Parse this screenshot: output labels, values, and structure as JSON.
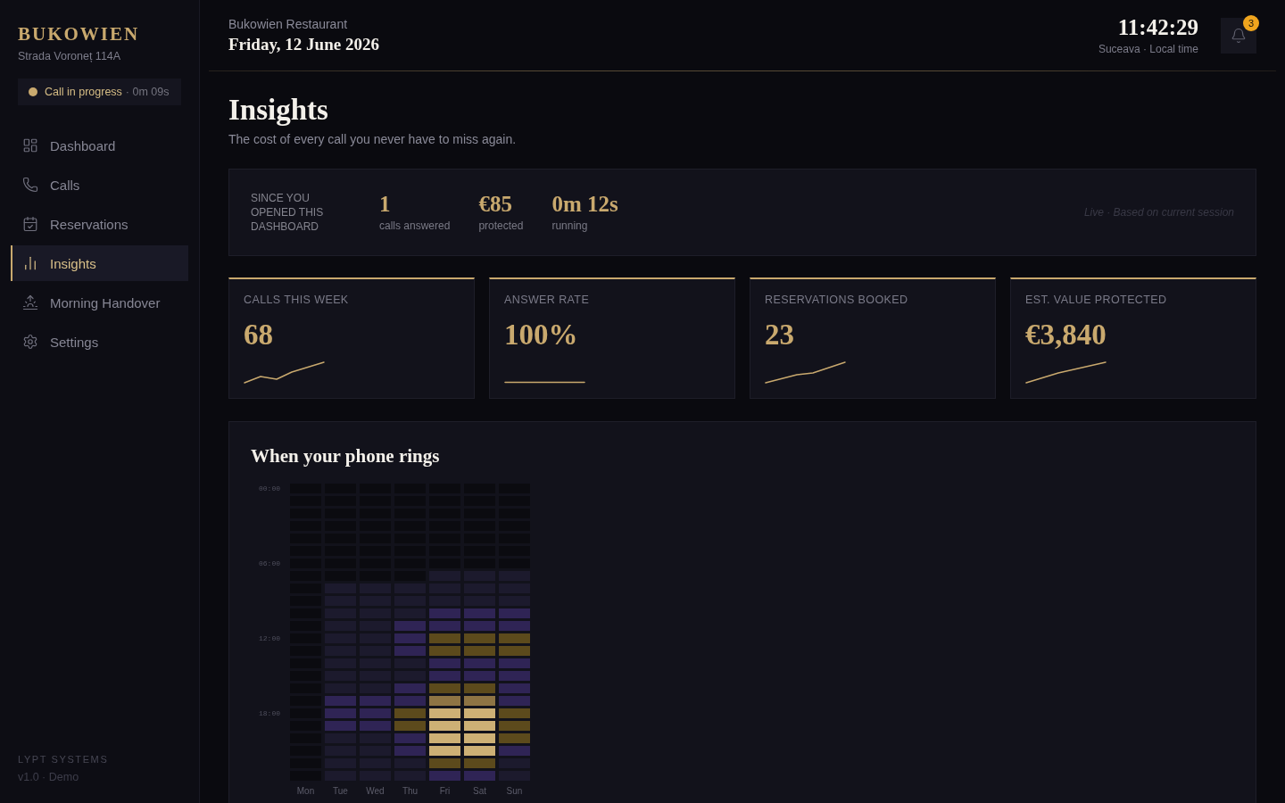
{
  "sidebar": {
    "brand": "BUKOWIEN",
    "address": "Strada Voroneț 114A",
    "call_status": {
      "label": "Call in progress",
      "elapsed": "· 0m 09s"
    },
    "nav": [
      {
        "label": "Dashboard",
        "selected": false
      },
      {
        "label": "Calls",
        "selected": false
      },
      {
        "label": "Reservations",
        "selected": false
      },
      {
        "label": "Insights",
        "selected": true
      },
      {
        "label": "Morning Handover",
        "selected": false
      },
      {
        "label": "Settings",
        "selected": false
      }
    ],
    "footer": {
      "company": "LYPT SYSTEMS",
      "version": "v1.0 · Demo"
    }
  },
  "header": {
    "restaurant": "Bukowien Restaurant",
    "date": "Friday, 12 June 2026",
    "clock": "11:42:29",
    "clock_caption": "Suceava · Local time",
    "notifications": {
      "count": "3"
    }
  },
  "page": {
    "title": "Insights",
    "subtitle": "The cost of every call you never have to miss again."
  },
  "session_summary": {
    "caption": "SINCE YOU OPENED THIS DASHBOARD",
    "stats": [
      {
        "value": "1",
        "label": "calls answered"
      },
      {
        "value": "€85",
        "label": "protected"
      },
      {
        "value": "0m 12s",
        "label": "running"
      }
    ],
    "note": "Live · Based on current session"
  },
  "kpis": [
    {
      "label": "CALLS THIS WEEK",
      "value": "68"
    },
    {
      "label": "ANSWER RATE",
      "value": "100%"
    },
    {
      "label": "RESERVATIONS BOOKED",
      "value": "23"
    },
    {
      "label": "EST. VALUE PROTECTED",
      "value": "€3,840"
    }
  ],
  "heatmap": {
    "title": "When your phone rings",
    "hour_labels": [
      "00:00",
      "06:00",
      "12:00",
      "18:00"
    ],
    "days": [
      {
        "label": "Mon",
        "cells": [
          {
            "color": "#0b0b10"
          },
          {
            "color": "#0b0b10"
          },
          {
            "color": "#0b0b10"
          },
          {
            "color": "#0b0b10"
          },
          {
            "color": "#0b0b10"
          },
          {
            "color": "#0b0b10"
          },
          {
            "color": "#0b0b10"
          },
          {
            "color": "#0b0b10"
          },
          {
            "color": "#0b0b10"
          },
          {
            "color": "#0b0b10"
          },
          {
            "color": "#0b0b10"
          },
          {
            "color": "#0b0b10"
          },
          {
            "color": "#0b0b10"
          },
          {
            "color": "#0b0b10"
          },
          {
            "color": "#0b0b10"
          },
          {
            "color": "#0b0b10"
          },
          {
            "color": "#0b0b10"
          },
          {
            "color": "#0b0b10"
          },
          {
            "color": "#0b0b10"
          },
          {
            "color": "#0b0b10"
          },
          {
            "color": "#0b0b10"
          },
          {
            "color": "#0b0b10"
          },
          {
            "color": "#0b0b10"
          },
          {
            "color": "#0b0b10"
          }
        ]
      },
      {
        "label": "Tue",
        "cells": [
          {
            "color": "#0b0b10"
          },
          {
            "color": "#0b0b10"
          },
          {
            "color": "#0b0b10"
          },
          {
            "color": "#0b0b10"
          },
          {
            "color": "#0b0b10"
          },
          {
            "color": "#0b0b10"
          },
          {
            "color": "#0b0b10"
          },
          {
            "color": "#0b0b10"
          },
          {
            "color": "#1c1a2d"
          },
          {
            "color": "#1c1a2d"
          },
          {
            "color": "#1c1a2d"
          },
          {
            "color": "#1c1a2d"
          },
          {
            "color": "#1c1a2d"
          },
          {
            "color": "#1c1a2d"
          },
          {
            "color": "#1c1a2d"
          },
          {
            "color": "#1c1a2d"
          },
          {
            "color": "#1c1a2d"
          },
          {
            "color": "#2f2455"
          },
          {
            "color": "#2f2455"
          },
          {
            "color": "#2f2455"
          },
          {
            "color": "#1c1a2d"
          },
          {
            "color": "#1c1a2d"
          },
          {
            "color": "#1c1a2d"
          },
          {
            "color": "#1c1a2d"
          }
        ]
      },
      {
        "label": "Wed",
        "cells": [
          {
            "color": "#0b0b10"
          },
          {
            "color": "#0b0b10"
          },
          {
            "color": "#0b0b10"
          },
          {
            "color": "#0b0b10"
          },
          {
            "color": "#0b0b10"
          },
          {
            "color": "#0b0b10"
          },
          {
            "color": "#0b0b10"
          },
          {
            "color": "#0b0b10"
          },
          {
            "color": "#1c1a2d"
          },
          {
            "color": "#1c1a2d"
          },
          {
            "color": "#1c1a2d"
          },
          {
            "color": "#1c1a2d"
          },
          {
            "color": "#1c1a2d"
          },
          {
            "color": "#1c1a2d"
          },
          {
            "color": "#1c1a2d"
          },
          {
            "color": "#1c1a2d"
          },
          {
            "color": "#1c1a2d"
          },
          {
            "color": "#2f2455"
          },
          {
            "color": "#2f2455"
          },
          {
            "color": "#2f2455"
          },
          {
            "color": "#1c1a2d"
          },
          {
            "color": "#1c1a2d"
          },
          {
            "color": "#1c1a2d"
          },
          {
            "color": "#1c1a2d"
          }
        ]
      },
      {
        "label": "Thu",
        "cells": [
          {
            "color": "#0b0b10"
          },
          {
            "color": "#0b0b10"
          },
          {
            "color": "#0b0b10"
          },
          {
            "color": "#0b0b10"
          },
          {
            "color": "#0b0b10"
          },
          {
            "color": "#0b0b10"
          },
          {
            "color": "#0b0b10"
          },
          {
            "color": "#0b0b10"
          },
          {
            "color": "#1c1a2d"
          },
          {
            "color": "#1c1a2d"
          },
          {
            "color": "#1c1a2d"
          },
          {
            "color": "#2f2455"
          },
          {
            "color": "#2f2455"
          },
          {
            "color": "#2f2455"
          },
          {
            "color": "#1c1a2d"
          },
          {
            "color": "#1c1a2d"
          },
          {
            "color": "#2f2455"
          },
          {
            "color": "#2f2455"
          },
          {
            "color": "#5c4a1c"
          },
          {
            "color": "#5c4a1c"
          },
          {
            "color": "#2f2455"
          },
          {
            "color": "#2f2455"
          },
          {
            "color": "#1c1a2d"
          },
          {
            "color": "#1c1a2d"
          }
        ]
      },
      {
        "label": "Fri",
        "cells": [
          {
            "color": "#0b0b10"
          },
          {
            "color": "#0b0b10"
          },
          {
            "color": "#0b0b10"
          },
          {
            "color": "#0b0b10"
          },
          {
            "color": "#0b0b10"
          },
          {
            "color": "#0b0b10"
          },
          {
            "color": "#0b0b10"
          },
          {
            "color": "#1c1a2d"
          },
          {
            "color": "#1c1a2d"
          },
          {
            "color": "#1c1a2d"
          },
          {
            "color": "#2f2455"
          },
          {
            "color": "#2f2455"
          },
          {
            "color": "#5c4a1c"
          },
          {
            "color": "#5c4a1c"
          },
          {
            "color": "#2f2455"
          },
          {
            "color": "#2f2455"
          },
          {
            "color": "#5c4a1c"
          },
          {
            "color": "#8e7444"
          },
          {
            "color": "#cdb075"
          },
          {
            "color": "#cdb075"
          },
          {
            "color": "#cdb075"
          },
          {
            "color": "#cdb075"
          },
          {
            "color": "#5c4a1c"
          },
          {
            "color": "#2f2455"
          }
        ]
      },
      {
        "label": "Sat",
        "cells": [
          {
            "color": "#0b0b10"
          },
          {
            "color": "#0b0b10"
          },
          {
            "color": "#0b0b10"
          },
          {
            "color": "#0b0b10"
          },
          {
            "color": "#0b0b10"
          },
          {
            "color": "#0b0b10"
          },
          {
            "color": "#0b0b10"
          },
          {
            "color": "#1c1a2d"
          },
          {
            "color": "#1c1a2d"
          },
          {
            "color": "#1c1a2d"
          },
          {
            "color": "#2f2455"
          },
          {
            "color": "#2f2455"
          },
          {
            "color": "#5c4a1c"
          },
          {
            "color": "#5c4a1c"
          },
          {
            "color": "#2f2455"
          },
          {
            "color": "#2f2455"
          },
          {
            "color": "#5c4a1c"
          },
          {
            "color": "#8e7444"
          },
          {
            "color": "#cdb075"
          },
          {
            "color": "#cdb075"
          },
          {
            "color": "#cdb075"
          },
          {
            "color": "#cdb075"
          },
          {
            "color": "#5c4a1c"
          },
          {
            "color": "#2f2455"
          }
        ]
      },
      {
        "label": "Sun",
        "cells": [
          {
            "color": "#0b0b10"
          },
          {
            "color": "#0b0b10"
          },
          {
            "color": "#0b0b10"
          },
          {
            "color": "#0b0b10"
          },
          {
            "color": "#0b0b10"
          },
          {
            "color": "#0b0b10"
          },
          {
            "color": "#0b0b10"
          },
          {
            "color": "#1c1a2d"
          },
          {
            "color": "#1c1a2d"
          },
          {
            "color": "#1c1a2d"
          },
          {
            "color": "#2f2455"
          },
          {
            "color": "#2f2455"
          },
          {
            "color": "#5c4a1c"
          },
          {
            "color": "#5c4a1c"
          },
          {
            "color": "#2f2455"
          },
          {
            "color": "#2f2455"
          },
          {
            "color": "#2f2455"
          },
          {
            "color": "#2f2455"
          },
          {
            "color": "#5c4a1c"
          },
          {
            "color": "#5c4a1c"
          },
          {
            "color": "#5c4a1c"
          },
          {
            "color": "#2f2455"
          },
          {
            "color": "#1c1a2d"
          },
          {
            "color": "#1c1a2d"
          }
        ]
      }
    ]
  }
}
